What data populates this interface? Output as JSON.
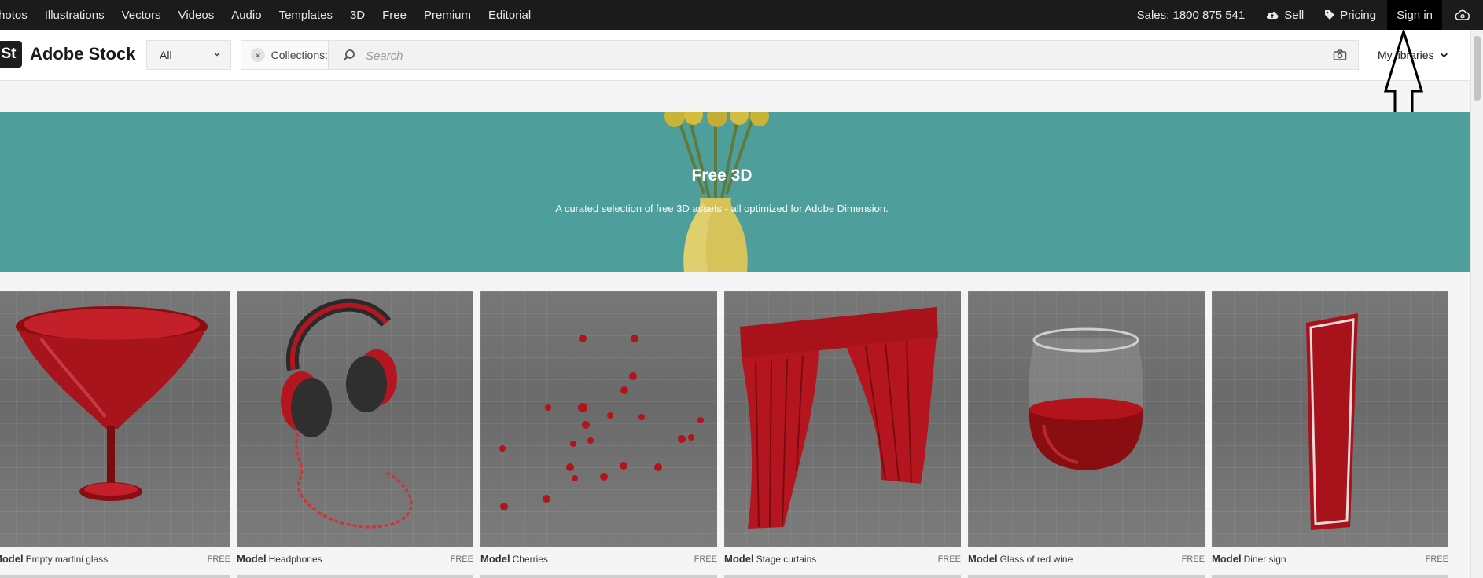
{
  "topnav": {
    "links": [
      "Photos",
      "Illustrations",
      "Vectors",
      "Videos",
      "Audio",
      "Templates",
      "3D",
      "Free",
      "Premium",
      "Editorial"
    ],
    "sales": "Sales: 1800 875 541",
    "sell": "Sell",
    "pricing": "Pricing",
    "signin": "Sign in"
  },
  "brand": {
    "badge": "St",
    "name": "Adobe Stock"
  },
  "search": {
    "scope": "All",
    "chip": "Collections:",
    "placeholder": "Search"
  },
  "libraries": "My libraries",
  "hero": {
    "title": "Free 3D",
    "subtitle": "A curated selection of free 3D assets - all optimized for Adobe Dimension."
  },
  "cards": [
    {
      "type": "Model",
      "name": "Empty martini glass",
      "badge": "FREE"
    },
    {
      "type": "Model",
      "name": "Headphones",
      "badge": "FREE"
    },
    {
      "type": "Model",
      "name": "Cherries",
      "badge": "FREE"
    },
    {
      "type": "Model",
      "name": "Stage curtains",
      "badge": "FREE"
    },
    {
      "type": "Model",
      "name": "Glass of red wine",
      "badge": "FREE"
    },
    {
      "type": "Model",
      "name": "Diner sign",
      "badge": "FREE"
    }
  ],
  "colors": {
    "hero": "#4e9f9b",
    "nav": "#1b1b1b",
    "accent_red": "#b0141a"
  },
  "icons": [
    "upload-cloud-icon",
    "tag-icon",
    "creative-cloud-icon",
    "chevron-down-icon",
    "search-icon",
    "camera-icon",
    "close-icon"
  ]
}
